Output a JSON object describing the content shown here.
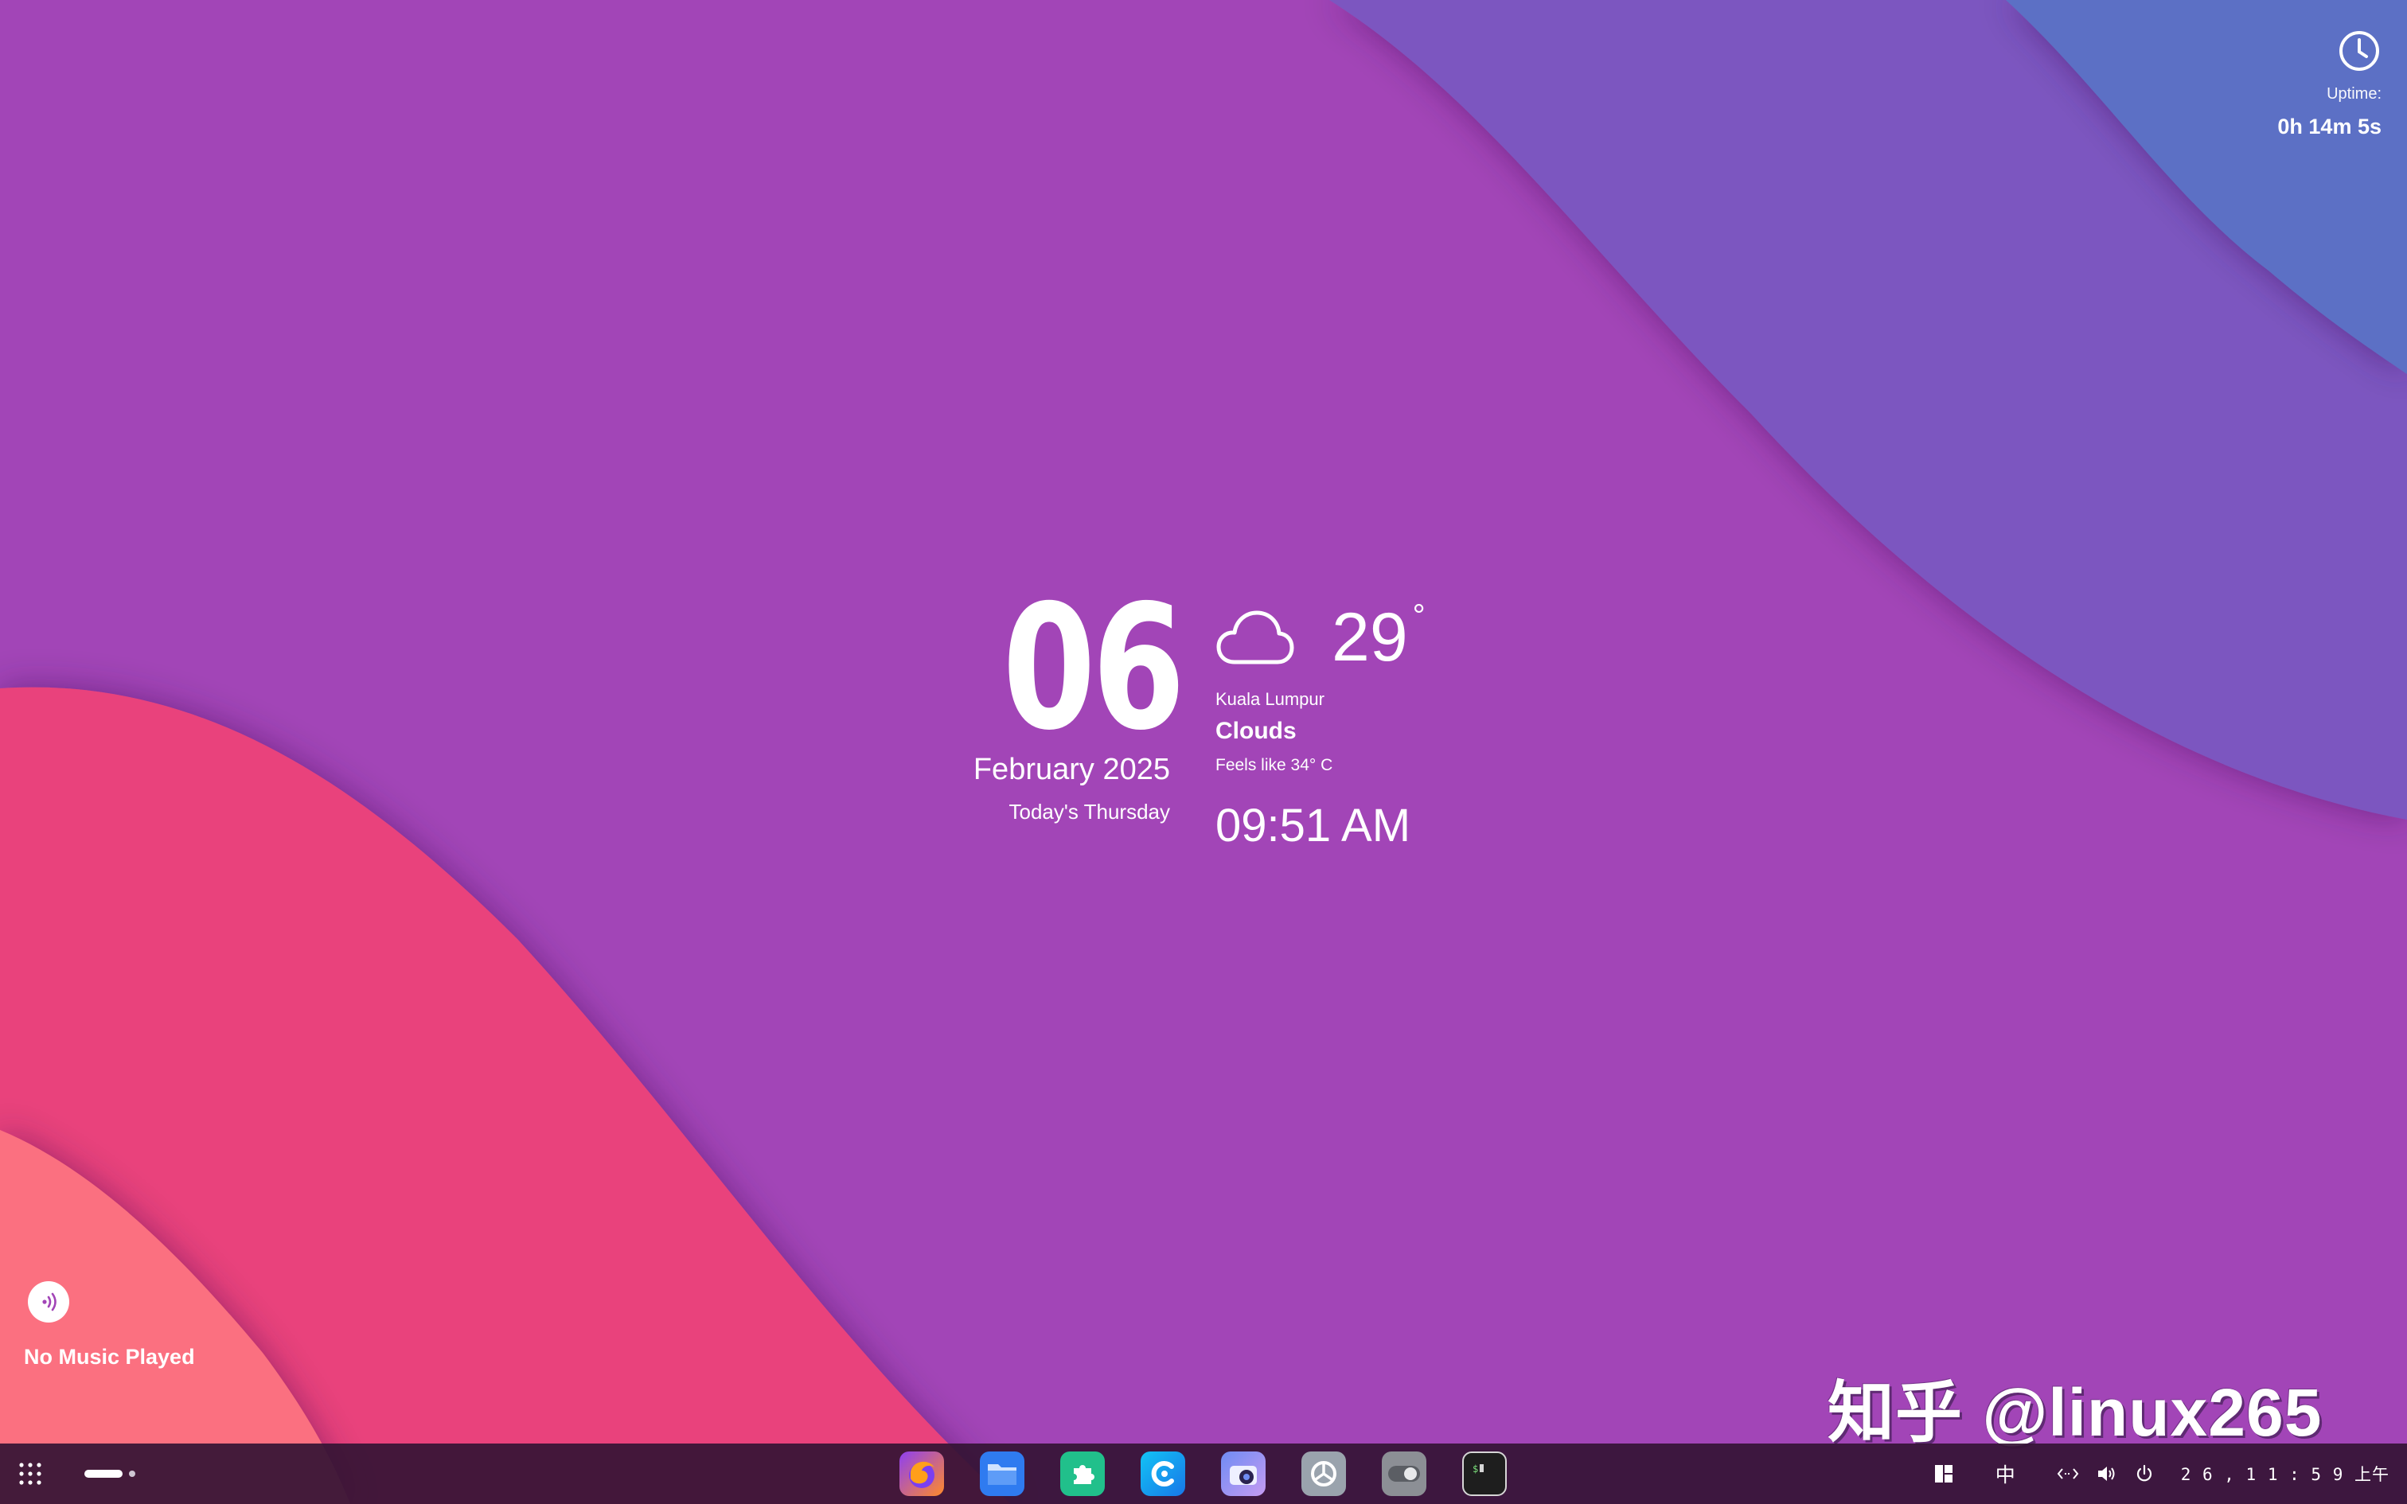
{
  "wallpaper": {
    "colors": {
      "base": "#a245b7",
      "top_right_violet": "#7c56c0",
      "top_right_blue": "#5b6fc5",
      "bottom_left_pink": "#e9437c",
      "bottom_left_salmon": "#fb6f80"
    }
  },
  "uptime": {
    "icon": "clock-icon",
    "label": "Uptime:",
    "value": "0h 14m 5s"
  },
  "date_widget": {
    "day": "06",
    "month_year": "February 2025",
    "weekday": "Today's Thursday"
  },
  "weather_widget": {
    "icon": "cloud-icon",
    "temperature": "29",
    "degree_symbol": "°",
    "city": "Kuala Lumpur",
    "condition": "Clouds",
    "feels_like": "Feels like 34° C",
    "time": "09:51 AM"
  },
  "music_widget": {
    "icon": "audio-wave-icon",
    "title": "No Music Played"
  },
  "watermark": "知乎 @linux265",
  "taskbar": {
    "launcher_icon": "grid-icon",
    "dock": [
      {
        "name": "firefox",
        "icon": "firefox-icon",
        "color": "#ff6d3a"
      },
      {
        "name": "files",
        "icon": "folder-icon",
        "color": "#2f7bf0"
      },
      {
        "name": "extensions",
        "icon": "puzzle-icon",
        "color": "#21c08b"
      },
      {
        "name": "browser-c",
        "icon": "c-logo-icon",
        "color": "#1ea8f0"
      },
      {
        "name": "screenshot",
        "icon": "camera-icon",
        "color": "#8a86ec"
      },
      {
        "name": "settings",
        "icon": "settings-icon",
        "color": "#9aa3ad"
      },
      {
        "name": "tweaks",
        "icon": "toggle-icon",
        "color": "#8c8f95"
      },
      {
        "name": "terminal",
        "icon": "terminal-icon",
        "color": "#1e1e1e"
      }
    ],
    "tray": {
      "layout_icon": "layout-icon",
      "input_method": "中",
      "network_icon": "network-icon",
      "volume_icon": "volume-icon",
      "power_icon": "power-icon",
      "clock": "2 6 , 1 1 : 5 9  上午"
    }
  }
}
